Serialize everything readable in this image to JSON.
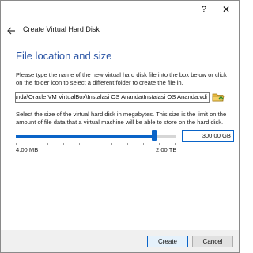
{
  "titlebar": {
    "help_label": "?",
    "close_label": "✕"
  },
  "header": {
    "back_icon": "arrow-left-icon",
    "title": "Create Virtual Hard Disk"
  },
  "page": {
    "heading": "File location and size",
    "location_description": "Please type the name of the new virtual hard disk file into the box below or click on the folder icon to select a different folder to create the file in.",
    "file_path": "C:\\Users\\Nanda\\Oracle VM VirtualBox\\Instalasi OS Ananda\\Instalasi OS Ananda.vdi",
    "folder_icon": "folder-icon",
    "size_description": "Select the size of the virtual hard disk in megabytes. This size is the limit on the amount of file data that a virtual machine will be able to store on the hard disk.",
    "slider": {
      "min_label": "4.00 MB",
      "max_label": "2.00 TB",
      "position_fraction": 0.865
    },
    "size_value": "300,00 GB"
  },
  "footer": {
    "create_label": "Create",
    "cancel_label": "Cancel"
  },
  "colors": {
    "accent": "#0a64c8",
    "heading": "#2b55a5"
  }
}
